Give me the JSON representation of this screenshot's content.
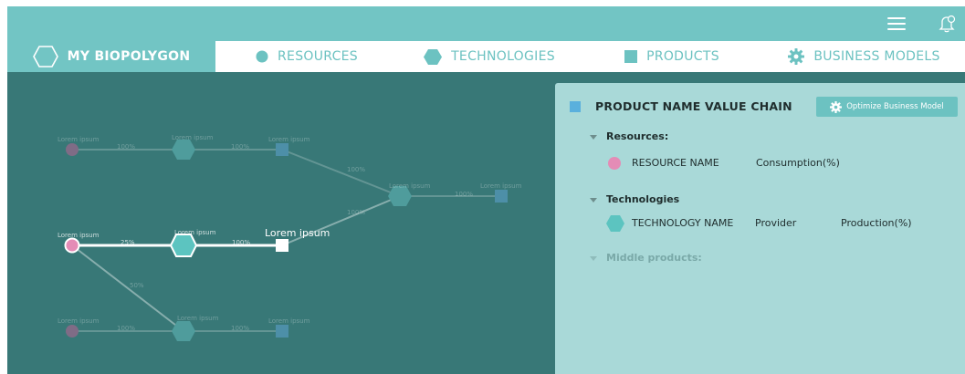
{
  "nav": {
    "tabs": [
      {
        "label": "MY BIOPOLYGON",
        "icon": "hexagon-outline-icon"
      },
      {
        "label": "RESOURCES",
        "icon": "circle-icon"
      },
      {
        "label": "TECHNOLOGIES",
        "icon": "hexagon-icon"
      },
      {
        "label": "PRODUCTS",
        "icon": "square-icon"
      },
      {
        "label": "BUSINESS MODELS",
        "icon": "gear-icon"
      }
    ]
  },
  "header": {
    "menu_icon": "hamburger-menu-icon",
    "notification_icon": "bell-icon"
  },
  "graph": {
    "top_row": {
      "resource": "Lorem ipsum",
      "pct1": "100%",
      "tech": "Lorem ipsum",
      "pct2": "100%",
      "product": "Lorem ipsum"
    },
    "merge": {
      "pct_up": "100%",
      "pct_down": "100%",
      "node": "Lorem ipsum",
      "pct_out": "100%",
      "final": "Lorem ipsum"
    },
    "middle_row": {
      "resource": "Lorem ipsum",
      "pct1": "25%",
      "tech": "Lorem ipsum",
      "pct2": "100%",
      "product": "Lorem ipsum"
    },
    "diag_pct": "50%",
    "bottom_row": {
      "resource": "Lorem ipsum",
      "pct1": "100%",
      "tech": "Lorem ipsum",
      "pct2": "100%",
      "product": "Lorem ipsum"
    }
  },
  "panel": {
    "title": "PRODUCT NAME VALUE CHAIN",
    "optimize_label": "Optimize Business Model",
    "resources_label": "Resources:",
    "resource_row": {
      "name": "RESOURCE NAME",
      "col2": "Consumption(%)"
    },
    "technologies_label": "Technologies",
    "technology_row": {
      "name": "TECHNOLOGY NAME",
      "col2": "Provider",
      "col3": "Production(%)"
    },
    "middle_products_label": "Middle products:"
  },
  "colors": {
    "accent": "#72c5c4",
    "graph_bg": "#387877",
    "panel_bg": "#a9d9d8",
    "resource": "#e48cb6",
    "technology": "#5cc4c0",
    "product": "#5ab0dd"
  }
}
